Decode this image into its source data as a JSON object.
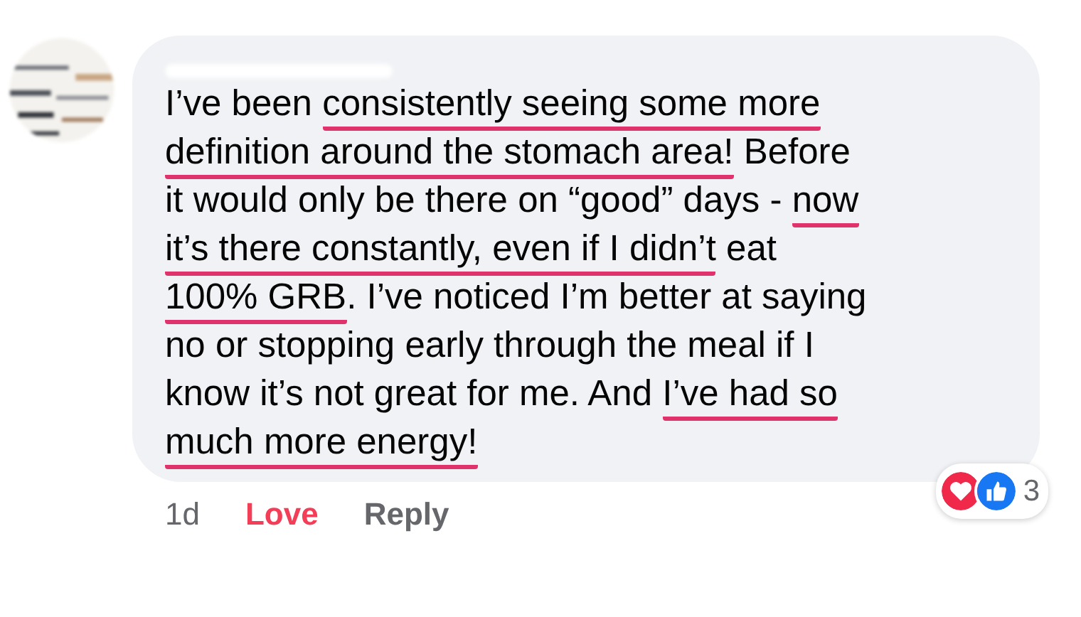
{
  "comment": {
    "lines": [
      [
        {
          "text": "I’ve been ",
          "underlined": false
        },
        {
          "text": "consistently seeing some more",
          "underlined": true
        }
      ],
      [
        {
          "text": "definition around the stomach area!",
          "underlined": true
        },
        {
          "text": " Before",
          "underlined": false
        }
      ],
      [
        {
          "text": "it would only be there on “good” days - ",
          "underlined": false
        },
        {
          "text": "now",
          "underlined": true
        }
      ],
      [
        {
          "text": "it’s there constantly, even if I didn’t",
          "underlined": true
        },
        {
          "text": " eat",
          "underlined": false
        }
      ],
      [
        {
          "text": "100% GRB",
          "underlined": true
        },
        {
          "text": ". I’ve noticed I’m better at saying",
          "underlined": false
        }
      ],
      [
        {
          "text": "no or stopping early through the meal if I",
          "underlined": false
        }
      ],
      [
        {
          "text": "know it’s not great for me. And ",
          "underlined": false
        },
        {
          "text": "I’ve had so",
          "underlined": true
        }
      ],
      [
        {
          "text": "much more energy!",
          "underlined": true
        }
      ]
    ],
    "time": "1d",
    "reaction_label": "Love",
    "reply": "Reply",
    "reactions_count": "3"
  }
}
